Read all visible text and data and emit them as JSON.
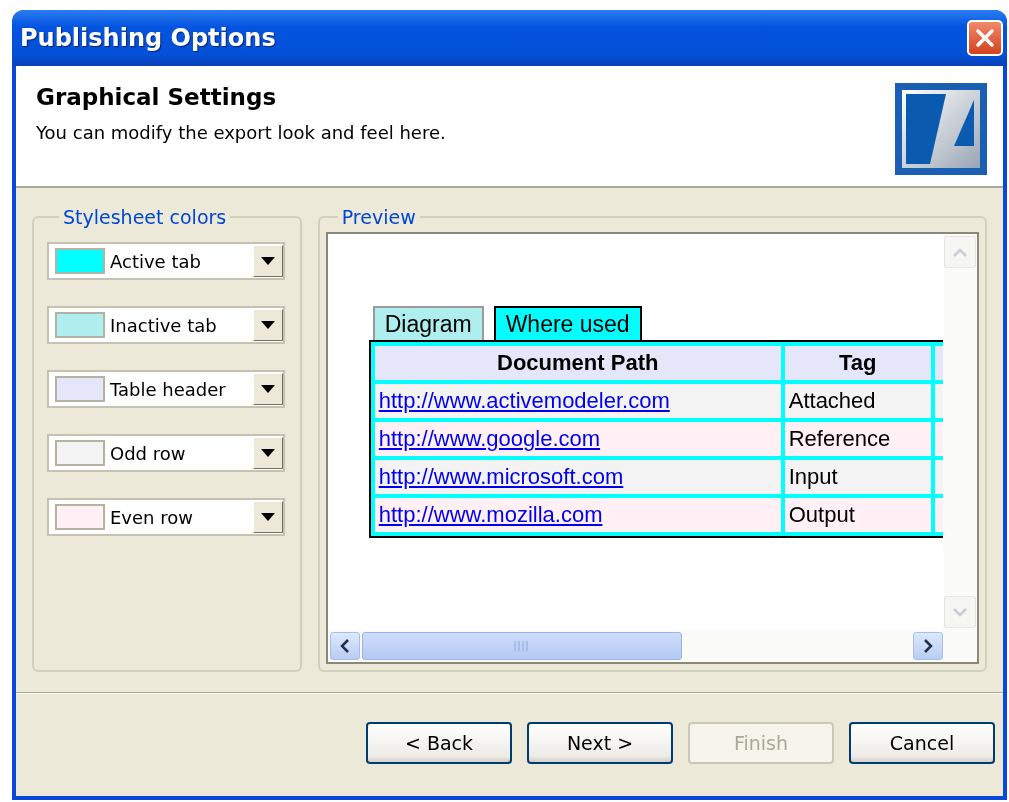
{
  "window": {
    "title": "Publishing Options"
  },
  "header": {
    "heading": "Graphical Settings",
    "description": "You can modify the export look and feel here."
  },
  "stylesheet_colors": {
    "label": "Stylesheet colors",
    "items": [
      {
        "label": "Active tab",
        "color": "#00ffff"
      },
      {
        "label": "Inactive tab",
        "color": "#afeeee"
      },
      {
        "label": "Table header",
        "color": "#e6e6fa"
      },
      {
        "label": "Odd row",
        "color": "#f3f3f3"
      },
      {
        "label": "Even row",
        "color": "#fff0f5"
      }
    ]
  },
  "preview": {
    "label": "Preview",
    "tabs": [
      {
        "label": "Diagram",
        "selected": false
      },
      {
        "label": "Where used",
        "selected": true
      }
    ],
    "table": {
      "columns": [
        "Document Path",
        "Tag"
      ],
      "rows": [
        {
          "document_path": "http://www.activemodeler.com",
          "tag": "Attached"
        },
        {
          "document_path": "http://www.google.com",
          "tag": "Reference"
        },
        {
          "document_path": "http://www.microsoft.com",
          "tag": "Input"
        },
        {
          "document_path": "http://www.mozilla.com",
          "tag": "Output"
        }
      ]
    }
  },
  "buttons": [
    {
      "label": "< Back",
      "disabled": false
    },
    {
      "label": "Next >",
      "disabled": false
    },
    {
      "label": "Finish",
      "disabled": true
    },
    {
      "label": "Cancel",
      "disabled": false
    }
  ]
}
